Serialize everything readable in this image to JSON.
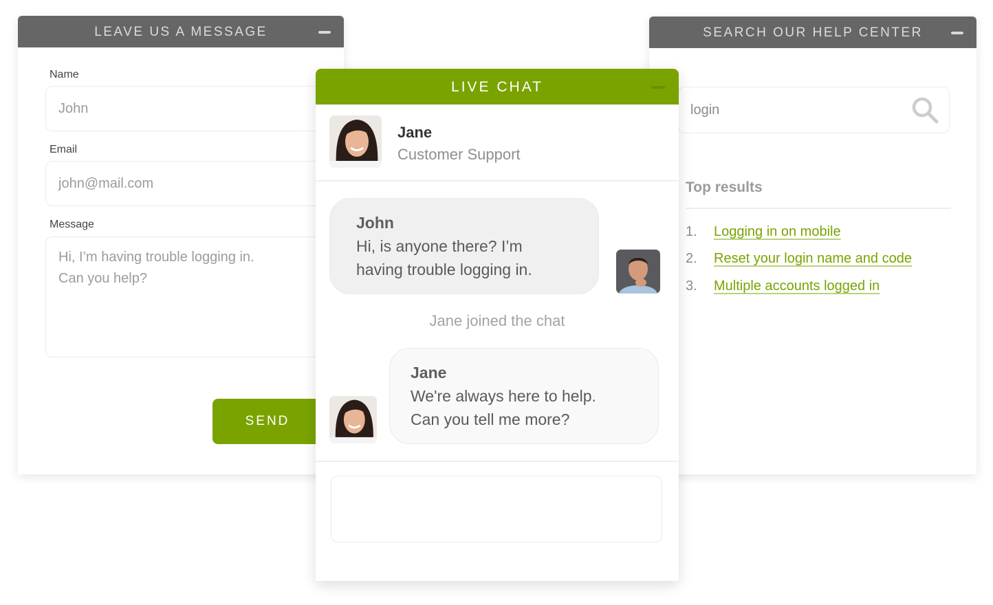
{
  "message_panel": {
    "title": "LEAVE US A MESSAGE",
    "fields": [
      {
        "label": "Name",
        "placeholder": "John"
      },
      {
        "label": "Email",
        "placeholder": "john@mail.com"
      },
      {
        "label": "Message",
        "placeholder_lines": [
          "Hi, I’m having trouble logging in.",
          "Can you help?"
        ]
      }
    ],
    "send_label": "SEND"
  },
  "help_panel": {
    "title": "SEARCH OUR HELP CENTER",
    "search_value": "login",
    "top_results_label": "Top results",
    "results": [
      {
        "num": "1.",
        "title": "Logging in on mobile"
      },
      {
        "num": "2.",
        "title": "Reset your login name and code"
      },
      {
        "num": "3.",
        "title": "Multiple accounts logged in"
      }
    ]
  },
  "chat_panel": {
    "title": "LIVE CHAT",
    "agent": {
      "name": "Jane",
      "role": "Customer Support"
    },
    "messages": [
      {
        "sender": "John",
        "lines": [
          "Hi, is anyone there? I’m",
          "having trouble logging in."
        ]
      },
      {
        "sender": "Jane",
        "lines": [
          "We're always here to help.",
          "Can you tell me more?"
        ]
      }
    ],
    "system_message": "Jane joined the chat",
    "input_value": ""
  },
  "colors": {
    "accent": "#7aa300",
    "header_gray": "#666666",
    "link": "#7aa300"
  }
}
